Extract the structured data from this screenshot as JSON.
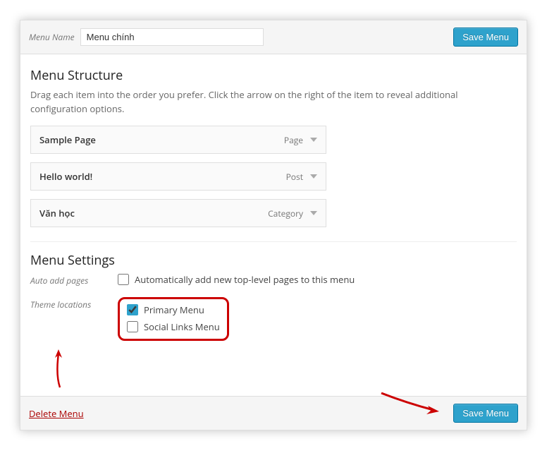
{
  "header": {
    "menuNameLabel": "Menu Name",
    "menuNameValue": "Menu chính",
    "saveLabel": "Save Menu"
  },
  "structure": {
    "title": "Menu Structure",
    "description": "Drag each item into the order you prefer. Click the arrow on the right of the item to reveal additional configuration options.",
    "items": [
      {
        "title": "Sample Page",
        "type": "Page"
      },
      {
        "title": "Hello world!",
        "type": "Post"
      },
      {
        "title": "Văn học",
        "type": "Category"
      }
    ]
  },
  "settings": {
    "title": "Menu Settings",
    "autoAddLabel": "Auto add pages",
    "autoAddOption": "Automatically add new top-level pages to this menu",
    "autoAddChecked": "false",
    "themeLocLabel": "Theme locations",
    "locations": [
      {
        "label": "Primary Menu",
        "checked": true
      },
      {
        "label": "Social Links Menu",
        "checked": false
      }
    ]
  },
  "footer": {
    "deleteLabel": "Delete Menu",
    "saveLabel": "Save Menu"
  }
}
